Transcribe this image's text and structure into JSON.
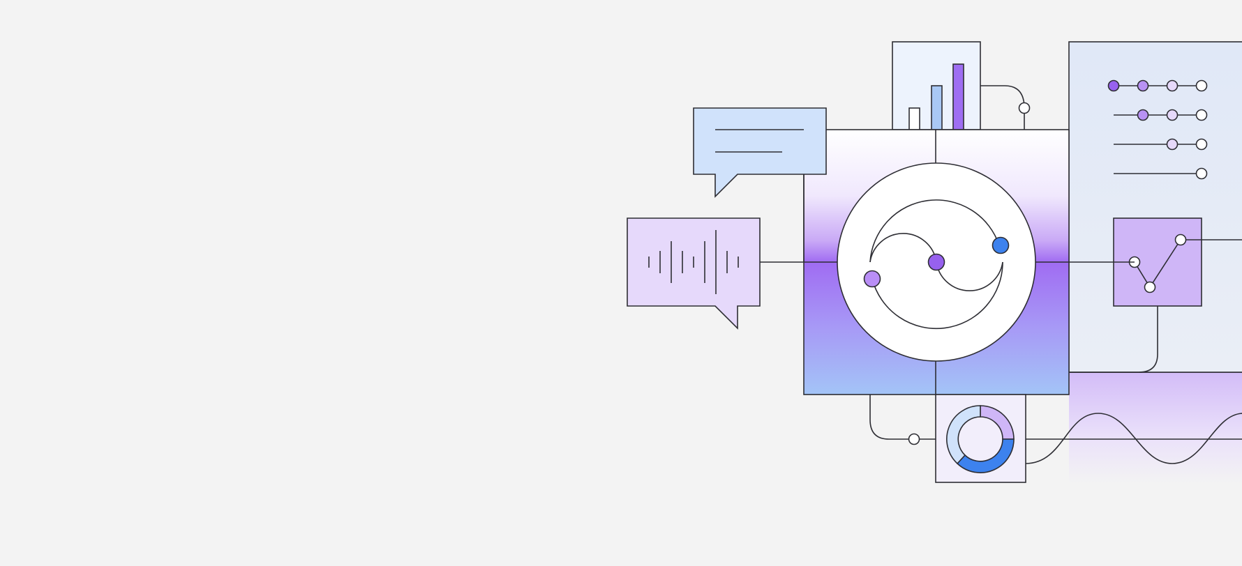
{
  "colors": {
    "background": "#f3f3f3",
    "stroke": "#2d2d33",
    "blue_light": "#d0e2fb",
    "blue_pale": "#edf3fd",
    "blue_accent": "#3d82ee",
    "blue_bar": "#a9c8f4",
    "lavender": "#e6d9fb",
    "lavender_mid": "#cfb6f7",
    "purple": "#a06cf2",
    "purple_deep": "#9761ee",
    "panel_grey": "#dfe5f2",
    "white": "#ffffff"
  },
  "icons": {
    "chat_bubble": "chat-bubble-icon",
    "voice_bubble": "voice-waveform-icon",
    "bar_chart": "bar-chart-icon",
    "slider_panel": "slider-settings-icon",
    "line_chart": "line-chart-icon",
    "donut_chart": "donut-chart-icon",
    "central_hub": "ai-swirl-hub-icon",
    "wave": "sine-wave-icon"
  },
  "bar_chart_levels": [
    0.33,
    0.67,
    1.0
  ],
  "slider_positions": [
    0,
    1,
    2,
    3
  ],
  "donut_shares": [
    0.22,
    0.5,
    0.28
  ]
}
